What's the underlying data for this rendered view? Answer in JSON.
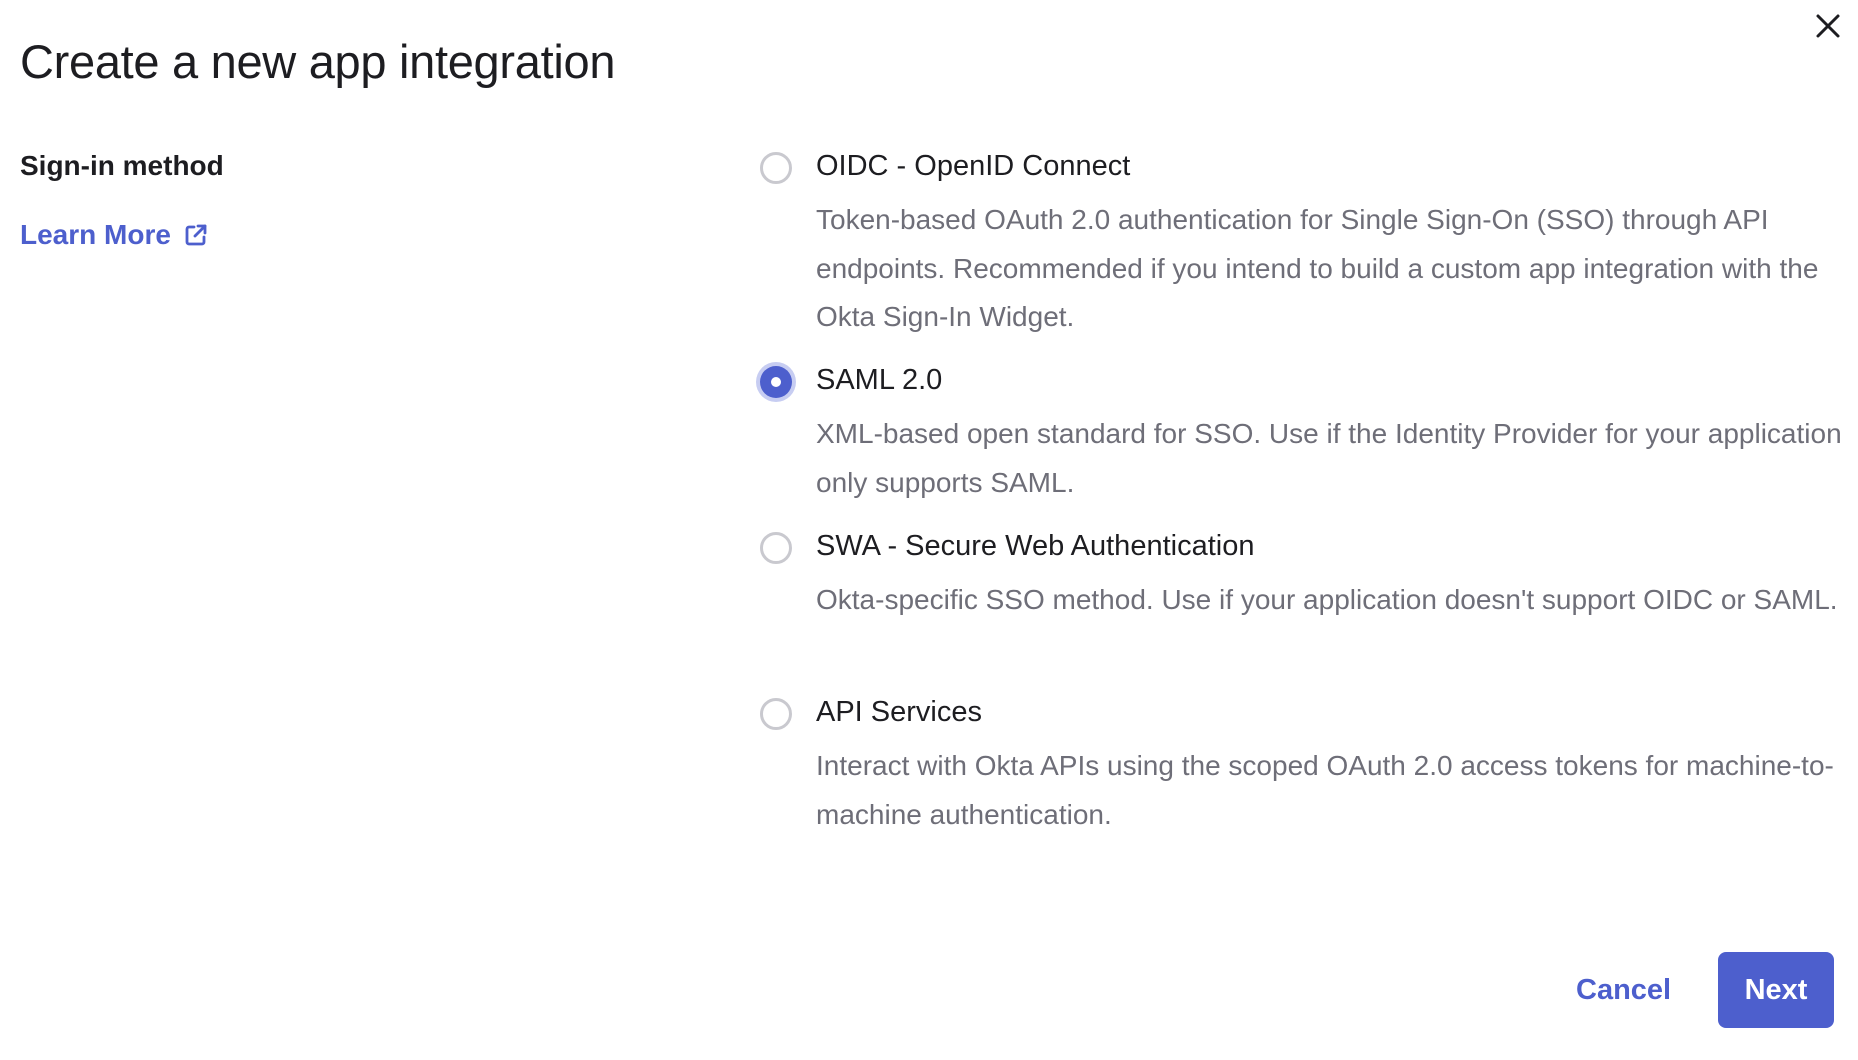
{
  "dialog": {
    "title": "Create a new app integration"
  },
  "section": {
    "label": "Sign-in method",
    "learn_more": "Learn More"
  },
  "options": [
    {
      "label": "OIDC - OpenID Connect",
      "description": "Token-based OAuth 2.0 authentication for Single Sign-On (SSO) through API endpoints. Recommended if you intend to build a custom app integration with the Okta Sign-In Widget.",
      "selected": false
    },
    {
      "label": "SAML 2.0",
      "description": "XML-based open standard for SSO. Use if the Identity Provider for your application only supports SAML.",
      "selected": true
    },
    {
      "label": "SWA - Secure Web Authentication",
      "description": "Okta-specific SSO method. Use if your application doesn't support OIDC or SAML.",
      "selected": false
    },
    {
      "label": "API Services",
      "description": "Interact with Okta APIs using the scoped OAuth 2.0 access tokens for machine-to-machine authentication.",
      "selected": false
    }
  ],
  "footer": {
    "cancel_label": "Cancel",
    "next_label": "Next"
  },
  "colors": {
    "accent": "#4d5fcd",
    "text_primary": "#1d1d21",
    "text_secondary": "#6e6e78",
    "radio_border": "#c9c9cf"
  },
  "icons": {
    "close": "close-icon",
    "external_link": "external-link-icon"
  }
}
